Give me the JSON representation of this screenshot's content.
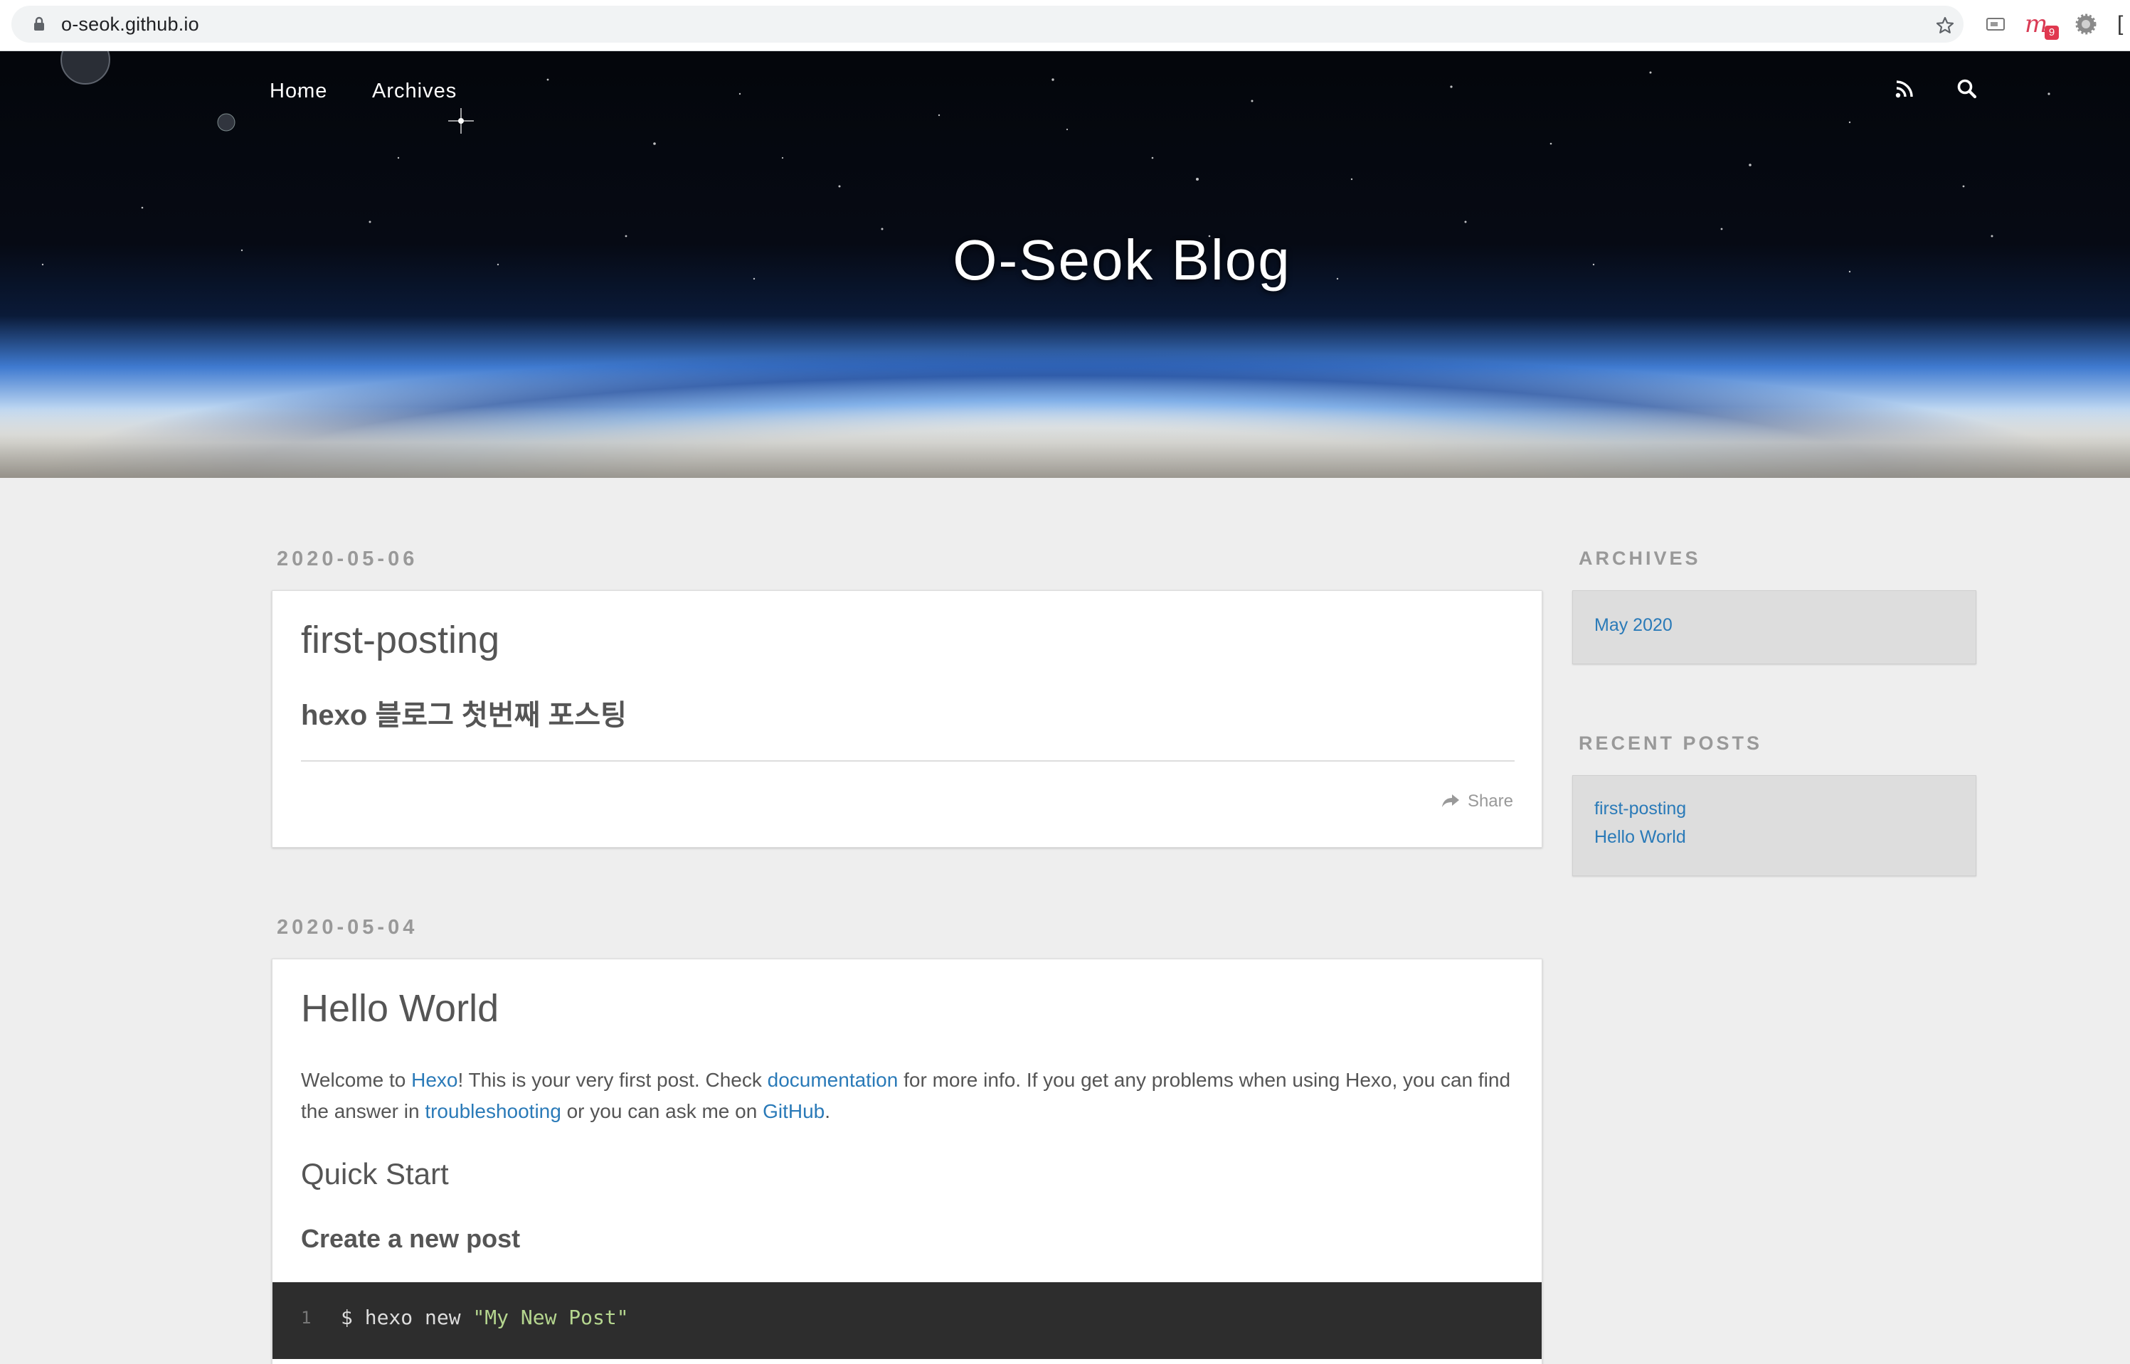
{
  "browser": {
    "url": "o-seok.github.io",
    "extension_badge": "9"
  },
  "header": {
    "nav": [
      "Home",
      "Archives"
    ],
    "site_title": "O-Seok Blog"
  },
  "posts": [
    {
      "date": "2020-05-06",
      "title": "first-posting",
      "subtitle": "hexo 블로그 첫번째 포스팅",
      "share_label": "Share"
    },
    {
      "date": "2020-05-04",
      "title": "Hello World",
      "intro": {
        "t1": "Welcome to ",
        "link1": "Hexo",
        "t2": "! This is your very first post. Check ",
        "link2": "documentation",
        "t3": " for more info. If you get any problems when using Hexo, you can find the answer in ",
        "link3": "troubleshooting",
        "t4": " or you can ask me on ",
        "link4": "GitHub",
        "t5": "."
      },
      "h2": "Quick Start",
      "h3": "Create a new post",
      "code": {
        "line_no": "1",
        "command": "$ hexo new ",
        "string": "\"My New Post\""
      }
    }
  ],
  "sidebar": {
    "archives_title": "ARCHIVES",
    "archives": [
      "May 2020"
    ],
    "recent_title": "RECENT POSTS",
    "recent": [
      "first-posting",
      "Hello World"
    ]
  },
  "colors": {
    "link": "#2a7ab8",
    "page_bg": "#eeeeee",
    "code_bg": "#2d2d2d"
  }
}
